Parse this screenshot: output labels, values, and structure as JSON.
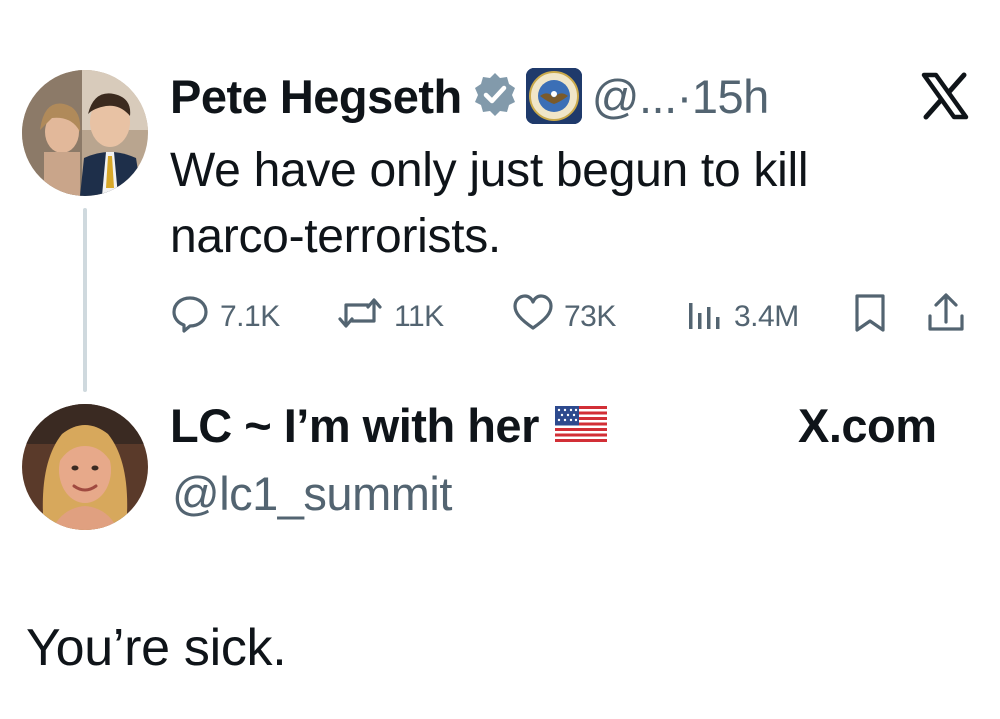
{
  "parent_tweet": {
    "author_name": "Pete Hegseth",
    "handle": "@...",
    "separator": "·",
    "time": "15h",
    "text": "We have only just begun to kill narco-terrorists.",
    "metrics": {
      "replies": "7.1K",
      "reposts": "11K",
      "likes": "73K",
      "views": "3.4M"
    },
    "icons": {
      "verified": "verified-badge-icon",
      "affiliation": "department-seal-icon",
      "platform": "x-logo-icon"
    }
  },
  "reply_tweet": {
    "author_name": "LC ~ I’m with her",
    "handle": "@lc1_summit",
    "text": "You’re sick.",
    "flag_icon": "us-flag-icon",
    "site_label": "X.com"
  },
  "colors": {
    "text": "#0f1419",
    "secondary": "#536471",
    "thread_line": "#cfd9de",
    "verified_badge": "#829aab"
  }
}
